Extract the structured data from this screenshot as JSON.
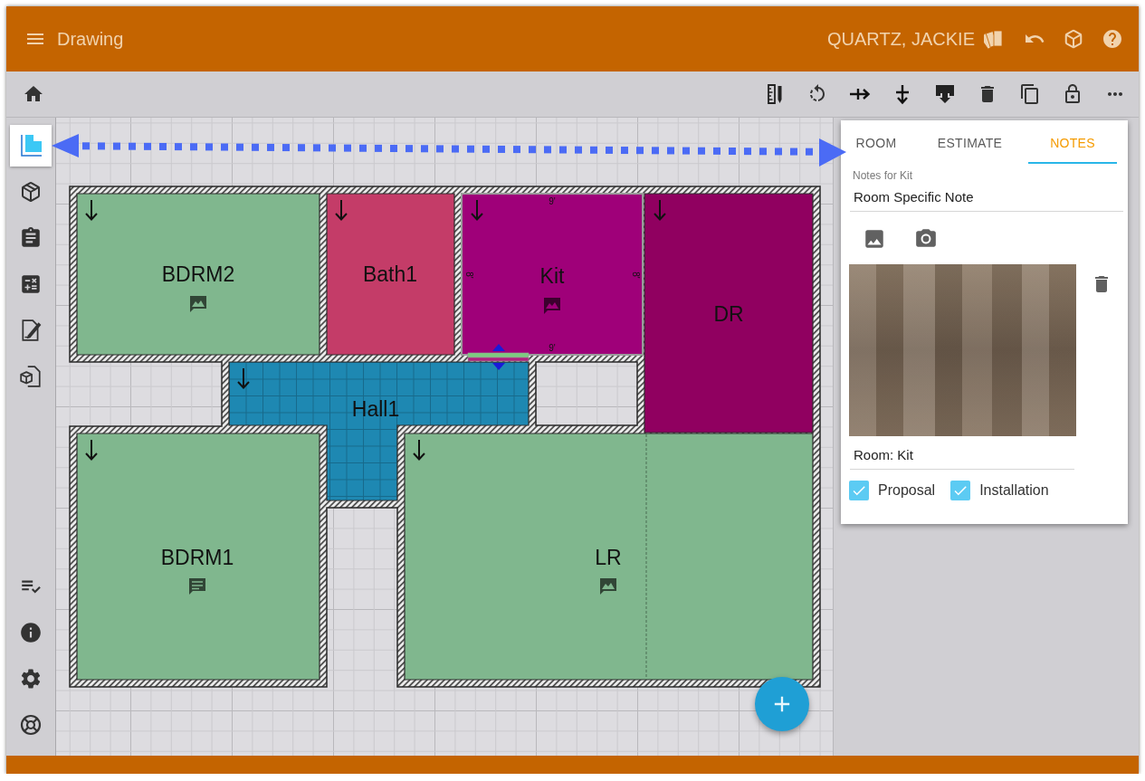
{
  "app_bar": {
    "title": "Drawing",
    "user": "QUARTZ, JACKIE"
  },
  "sidebar": {
    "items": [
      {
        "kind": "floor-plan",
        "selected": true
      },
      {
        "kind": "package",
        "selected": false
      },
      {
        "kind": "clipboard",
        "selected": false
      },
      {
        "kind": "calculator",
        "selected": false
      },
      {
        "kind": "signature",
        "selected": false
      },
      {
        "kind": "product-sheet",
        "selected": false
      }
    ],
    "footer_items": [
      {
        "kind": "checklist"
      },
      {
        "kind": "info"
      },
      {
        "kind": "settings"
      },
      {
        "kind": "support"
      }
    ]
  },
  "floor_plan": {
    "rooms": [
      {
        "name": "BDRM2",
        "color": "#80b78e",
        "note": {
          "kind": "image"
        },
        "tiled": false,
        "selected": false
      },
      {
        "name": "Bath1",
        "color": "#c43c68",
        "tiled": false,
        "selected": false
      },
      {
        "name": "Kit",
        "color": "#9f0079",
        "note": {
          "kind": "image"
        },
        "tiled": false,
        "selected": true,
        "dimensions": {
          "top": "9'",
          "left": "8'",
          "right": "8'",
          "bottom": "9'"
        }
      },
      {
        "name": "DR",
        "color": "#900060",
        "tiled": false,
        "selected": false
      },
      {
        "name": "Hall1",
        "color": "#1e88b2",
        "tiled": true,
        "selected": false
      },
      {
        "name": "BDRM1",
        "color": "#80b78e",
        "note": {
          "kind": "comment"
        },
        "tiled": false,
        "selected": false
      },
      {
        "name": "LR",
        "color": "#80b78e",
        "note": {
          "kind": "image"
        },
        "tiled": false,
        "selected": false
      }
    ]
  },
  "panel": {
    "tabs": [
      {
        "label": "ROOM",
        "selected": false
      },
      {
        "label": "ESTIMATE",
        "selected": false
      },
      {
        "label": "NOTES",
        "selected": true
      }
    ],
    "notes_field": {
      "label": "Notes for Kit",
      "value": "Room Specific Note"
    },
    "caption_field": {
      "value": "Room: Kit"
    },
    "options": [
      {
        "label": "Proposal",
        "checked": true
      },
      {
        "label": "Installation",
        "checked": true
      }
    ]
  }
}
